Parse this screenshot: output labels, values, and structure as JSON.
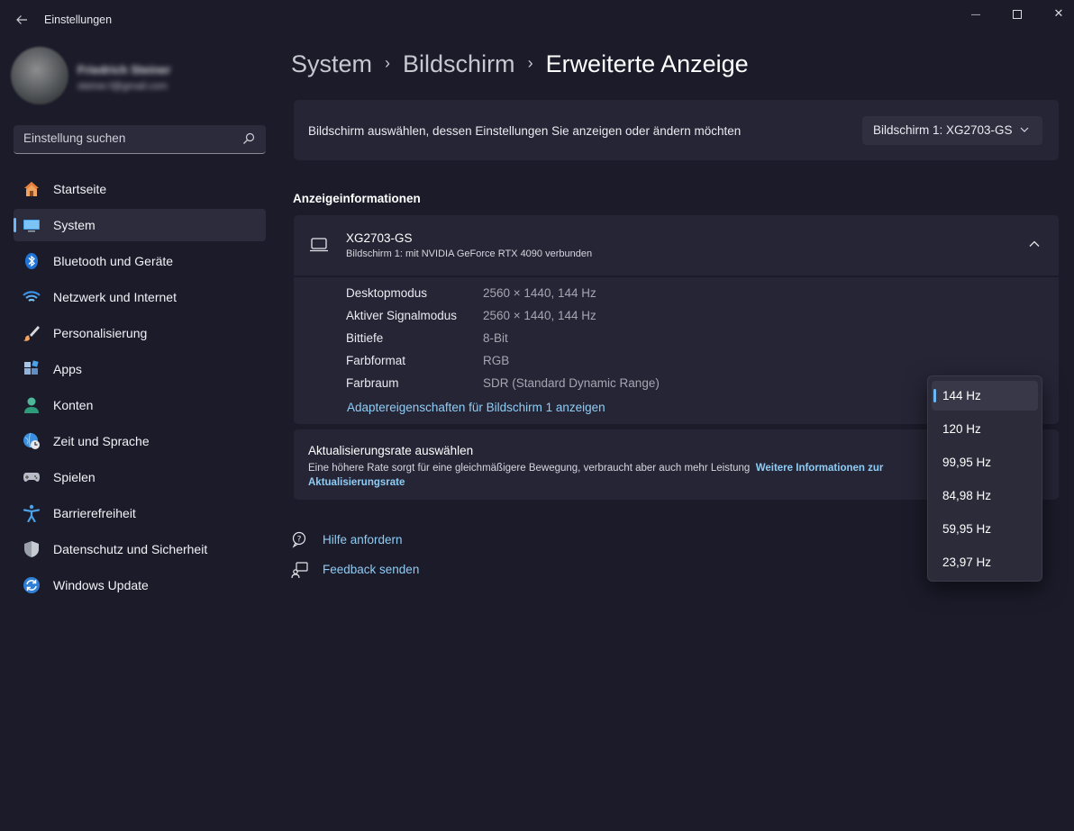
{
  "window": {
    "title": "Einstellungen",
    "controls": {
      "minimize": "—",
      "close": "✕"
    }
  },
  "profile": {
    "name": "Friedrich Steiner",
    "email": "steiner.f@gmail.com"
  },
  "search": {
    "placeholder": "Einstellung suchen"
  },
  "sidebar": {
    "items": [
      {
        "label": "Startseite",
        "icon": "home-icon"
      },
      {
        "label": "System",
        "icon": "monitor-icon",
        "active": true
      },
      {
        "label": "Bluetooth und Geräte",
        "icon": "bluetooth-icon"
      },
      {
        "label": "Netzwerk und Internet",
        "icon": "wifi-icon"
      },
      {
        "label": "Personalisierung",
        "icon": "brush-icon"
      },
      {
        "label": "Apps",
        "icon": "apps-icon"
      },
      {
        "label": "Konten",
        "icon": "person-icon"
      },
      {
        "label": "Zeit und Sprache",
        "icon": "globe-clock-icon"
      },
      {
        "label": "Spielen",
        "icon": "gamepad-icon"
      },
      {
        "label": "Barrierefreiheit",
        "icon": "accessibility-icon"
      },
      {
        "label": "Datenschutz und Sicherheit",
        "icon": "shield-icon"
      },
      {
        "label": "Windows Update",
        "icon": "update-icon"
      }
    ]
  },
  "breadcrumb": {
    "items": [
      "System",
      "Bildschirm"
    ],
    "current": "Erweiterte Anzeige",
    "separator": "›"
  },
  "display_select": {
    "label": "Bildschirm auswählen, dessen Einstellungen Sie anzeigen oder ändern möchten",
    "value": "Bildschirm 1: XG2703-GS"
  },
  "display_info": {
    "section_title": "Anzeigeinformationen",
    "monitor_name": "XG2703-GS",
    "monitor_subtitle": "Bildschirm 1: mit NVIDIA GeForce RTX 4090 verbunden",
    "rows": [
      {
        "key": "Desktopmodus",
        "value": "2560 × 1440, 144 Hz"
      },
      {
        "key": "Aktiver Signalmodus",
        "value": "2560 × 1440, 144 Hz"
      },
      {
        "key": "Bittiefe",
        "value": "8-Bit"
      },
      {
        "key": "Farbformat",
        "value": "RGB"
      },
      {
        "key": "Farbraum",
        "value": "SDR (Standard Dynamic Range)"
      }
    ],
    "adapter_link": "Adaptereigenschaften für Bildschirm 1 anzeigen"
  },
  "refresh_rate": {
    "title": "Aktualisierungsrate auswählen",
    "description": "Eine höhere Rate sorgt für eine gleichmäßigere Bewegung, verbraucht aber auch mehr Leistung",
    "more_link": "Weitere Informationen zur Aktualisierungsrate",
    "options": [
      "144 Hz",
      "120 Hz",
      "99,95 Hz",
      "84,98 Hz",
      "59,95 Hz",
      "23,97 Hz"
    ],
    "selected": "144 Hz"
  },
  "help": {
    "get_help": "Hilfe anfordern",
    "feedback": "Feedback senden"
  },
  "colors": {
    "background": "#1b1b2a",
    "card": "#252536",
    "accent": "#6cb8f6",
    "link": "#8fcdf5"
  }
}
